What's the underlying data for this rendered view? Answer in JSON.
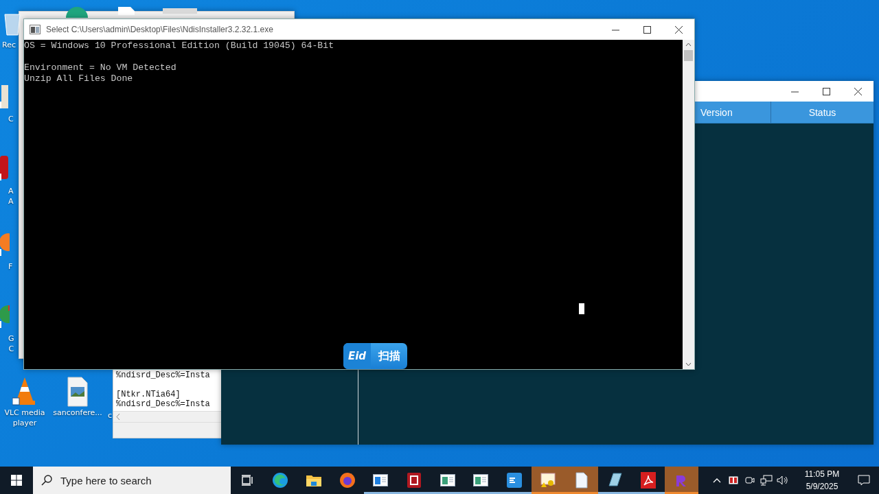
{
  "desktop": {
    "icons": [
      {
        "lines": [
          "Rec"
        ]
      },
      {
        "lines": [
          "C"
        ]
      },
      {
        "lines": [
          "A",
          "A"
        ]
      },
      {
        "lines": [
          "F"
        ]
      },
      {
        "lines": [
          "G",
          "C"
        ]
      },
      {
        "lines": [
          "VLC media",
          "player"
        ]
      },
      {
        "lines": [
          "sanconfere..."
        ]
      },
      {
        "lines": [
          "c"
        ]
      }
    ]
  },
  "app_window": {
    "columns": [
      "Version",
      "Status"
    ]
  },
  "notepad": {
    "paragraphs": [
      [
        "%ndisrd_Desc%=Insta"
      ],
      [
        "[Ntkr.NTia64]",
        "%ndisrd_Desc%=Insta"
      ]
    ]
  },
  "console": {
    "title": "Select C:\\Users\\admin\\Desktop\\Files\\NdisInstaller3.2.32.1.exe",
    "paragraphs": [
      [
        "OS = Windows 10 Professional Edition (Build 19045) 64-Bit"
      ],
      [
        "Environment = No VM Detected",
        "Unzip All Files Done"
      ]
    ]
  },
  "popup": {
    "logo": "Eid",
    "label": "扫描"
  },
  "taskbar": {
    "search": {
      "placeholder": "Type here to search"
    },
    "apps": [
      {
        "highlighted": false,
        "running": false
      },
      {
        "highlighted": false,
        "running": false
      },
      {
        "highlighted": false,
        "running": false
      },
      {
        "highlighted": false,
        "running": true
      },
      {
        "highlighted": false,
        "running": true
      },
      {
        "highlighted": false,
        "running": true
      },
      {
        "highlighted": false,
        "running": true
      },
      {
        "highlighted": false,
        "running": true
      },
      {
        "highlighted": true,
        "running": true
      },
      {
        "highlighted": true,
        "running": true
      },
      {
        "highlighted": false,
        "running": true
      },
      {
        "highlighted": false,
        "running": true
      },
      {
        "highlighted": true,
        "running": true
      }
    ],
    "clock": {
      "time": "11:05 PM",
      "date": "5/9/2025"
    }
  }
}
